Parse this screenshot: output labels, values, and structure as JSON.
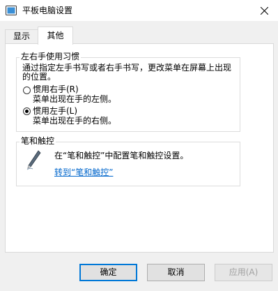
{
  "window": {
    "title": "平板电脑设置",
    "app_icon": "tablet-settings-icon",
    "close_icon": "close-icon"
  },
  "tabs": [
    {
      "label": "显示",
      "selected": false
    },
    {
      "label": "其他",
      "selected": true
    }
  ],
  "handedness": {
    "legend": "左右手使用习惯",
    "description": "通过指定左手书写或者右手书写，更改菜单在屏幕上出现的位置。",
    "options": [
      {
        "label": "惯用右手(R)",
        "sub": "菜单出现在手的左侧。",
        "checked": false
      },
      {
        "label": "惯用左手(L)",
        "sub": "菜单出现在手的右侧。",
        "checked": true
      }
    ]
  },
  "pen": {
    "legend": "笔和触控",
    "icon": "pen-icon",
    "description": "在“笔和触控”中配置笔和触控设置。",
    "link": "转到“笔和触控”"
  },
  "buttons": {
    "ok": "确定",
    "cancel": "取消",
    "apply": "应用(A)"
  },
  "colors": {
    "link": "#0066cc",
    "default_button_border": "#0078d7"
  }
}
